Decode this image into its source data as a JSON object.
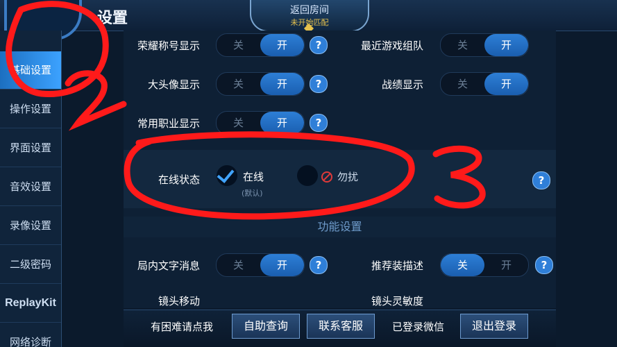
{
  "header": {
    "title": "设置",
    "room": {
      "main": "返回房间",
      "sub": "未开始匹配"
    }
  },
  "sidebar": {
    "items": [
      {
        "label": "基础设置",
        "active": true
      },
      {
        "label": "操作设置"
      },
      {
        "label": "界面设置"
      },
      {
        "label": "音效设置"
      },
      {
        "label": "录像设置"
      },
      {
        "label": "二级密码"
      },
      {
        "label": "ReplayKit"
      },
      {
        "label": "网络诊断"
      }
    ]
  },
  "settings": {
    "toggle_off": "关",
    "toggle_on": "开",
    "help": "?",
    "rows": [
      {
        "label": "荣耀称号显示",
        "state": "开"
      },
      {
        "label": "最近游戏组队",
        "state": "开"
      },
      {
        "label": "大头像显示",
        "state": "开"
      },
      {
        "label": "战绩显示",
        "state": "开"
      },
      {
        "label": "常用职业显示",
        "state": "开"
      }
    ],
    "online_status": {
      "label": "在线状态",
      "online": "在线",
      "default_note": "(默认)",
      "dnd": "勿扰",
      "selected": "在线"
    },
    "section_title": "功能设置",
    "feature_rows": [
      {
        "label": "局内文字消息",
        "state": "开"
      },
      {
        "label": "推荐装描述",
        "state": "关"
      }
    ],
    "partial_rows": [
      "镜头移动",
      "镜头灵敏度"
    ]
  },
  "bottom": {
    "help_text": "有困难请点我",
    "self_service": "自助查询",
    "contact": "联系客服",
    "login_status": "已登录微信",
    "logout": "退出登录"
  },
  "colors": {
    "accent": "#2d7fd6",
    "annotation": "#ff1a1a",
    "room_sub": "#e7c24d"
  },
  "annotations": [
    "2",
    "3"
  ]
}
